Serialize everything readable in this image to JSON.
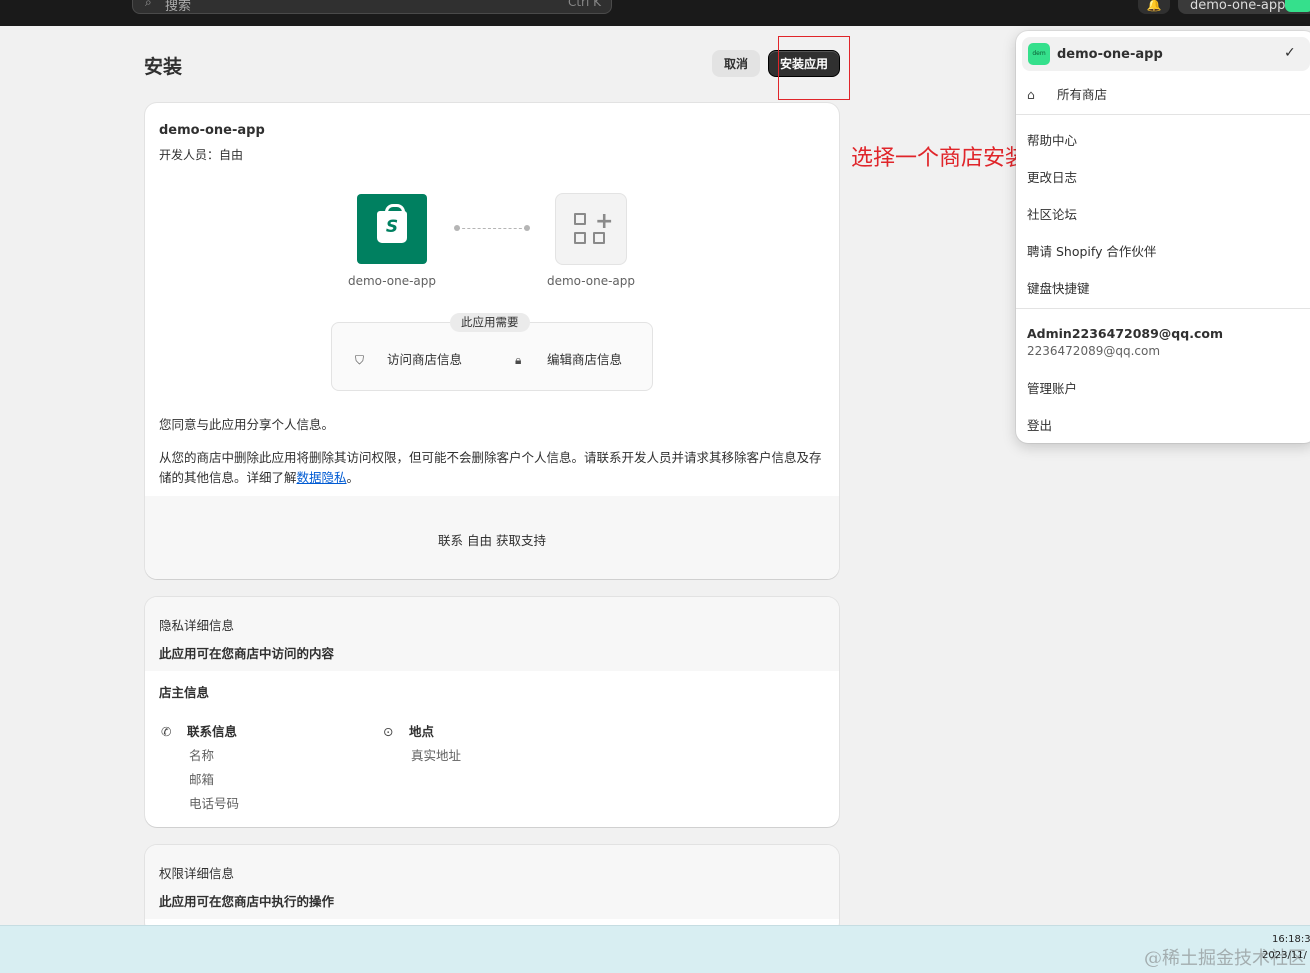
{
  "topbar": {
    "search_placeholder": "搜索",
    "search_shortcut": "Ctrl K",
    "store_name": "demo-one-app"
  },
  "header": {
    "title": "安装",
    "cancel_label": "取消",
    "install_label": "安装应用"
  },
  "annotation": {
    "text": "选择一个商店安装",
    "color": "#e0252a"
  },
  "app_card": {
    "app_name": "demo-one-app",
    "developer": "开发人员：自由",
    "app_tile_label": "demo-one-app",
    "store_tile_label": "demo-one-app",
    "requires_badge": "此应用需要",
    "permissions": [
      "访问商店信息",
      "编辑商店信息"
    ],
    "consent": "您同意与此应用分享个人信息。",
    "remove_text": "从您的商店中删除此应用将删除其访问权限，但可能不会删除客户个人信息。请联系开发人员并请求其移除客户信息及存储的其他信息。详细了解",
    "privacy_link": "数据隐私",
    "period": "。",
    "support": "联系 自由 获取支持"
  },
  "privacy_card": {
    "title": "隐私详细信息",
    "subtitle": "此应用可在您商店中访问的内容",
    "owner_heading": "店主信息",
    "contact_heading": "联系信息",
    "contact_items": [
      "名称",
      "邮箱",
      "电话号码"
    ],
    "location_heading": "地点",
    "location_items": [
      "真实地址"
    ]
  },
  "permission_card": {
    "title": "权限详细信息",
    "subtitle": "此应用可在您商店中执行的操作"
  },
  "dropdown": {
    "store_avatar": "dem",
    "store_name": "demo-one-app",
    "all_stores": "所有商店",
    "help": "帮助中心",
    "changelog": "更改日志",
    "community": "社区论坛",
    "hire": "聘请 Shopify 合作伙伴",
    "shortcuts": "键盘快捷键",
    "email_title": "Admin2236472089@qq.com",
    "email": "2236472089@qq.com",
    "manage_account": "管理账户",
    "logout": "登出"
  },
  "taskbar": {
    "time": "16:18:3",
    "date": "2023/11/",
    "watermark": "@稀土掘金技术社区"
  },
  "colors": {
    "brand_green": "#008060",
    "accent_red": "#e0252a",
    "avatar_green": "#35e08c"
  }
}
